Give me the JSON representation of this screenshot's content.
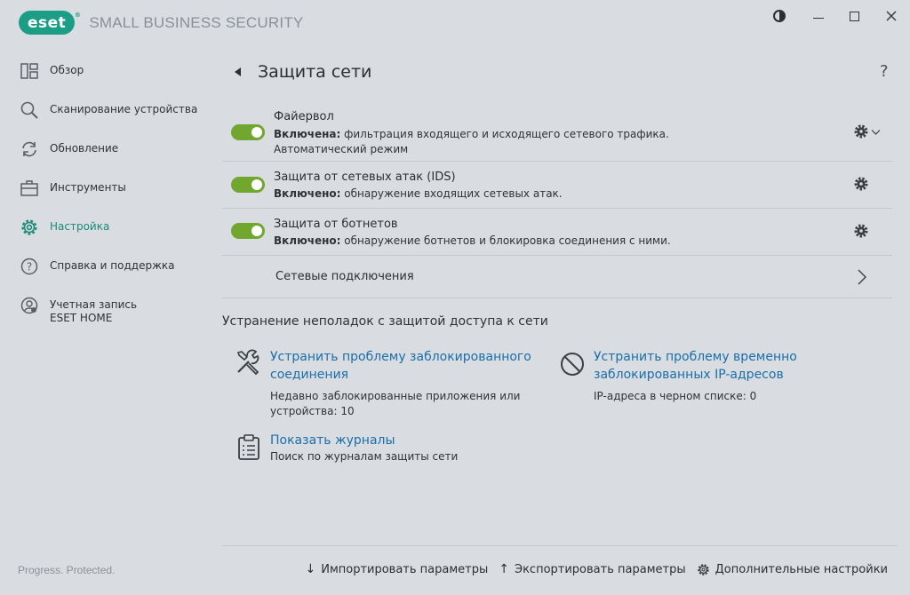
{
  "app": {
    "logo_text": "eset",
    "logo_tm": "®",
    "product_name": "SMALL BUSINESS SECURITY",
    "status_text": "Progress. Protected."
  },
  "sidebar": {
    "items": [
      {
        "label": "Обзор",
        "icon": "overview-icon"
      },
      {
        "label": "Сканирование устройства",
        "icon": "search-icon"
      },
      {
        "label": "Обновление",
        "icon": "refresh-icon"
      },
      {
        "label": "Инструменты",
        "icon": "briefcase-icon"
      },
      {
        "label": "Настройка",
        "icon": "gear-icon",
        "active": true
      },
      {
        "label": "Справка и поддержка",
        "icon": "help-icon"
      },
      {
        "label": "Учетная запись ESET HOME",
        "icon": "account-icon"
      }
    ]
  },
  "main": {
    "title": "Защита сети",
    "help": "?",
    "rows": [
      {
        "title": "Файервол",
        "status_bold": "Включена:",
        "status_text": " фильтрация входящего и исходящего сетевого трафика.",
        "extra": "Автоматический режим",
        "enabled": true
      },
      {
        "title": "Защита от сетевых атак (IDS)",
        "status_bold": "Включено:",
        "status_text": " обнаружение входящих сетевых атак.",
        "enabled": true
      },
      {
        "title": "Защита от ботнетов",
        "status_bold": "Включено:",
        "status_text": " обнаружение ботнетов и блокировка соединения с ними.",
        "enabled": true
      },
      {
        "title": "Сетевые подключения"
      }
    ],
    "troubleshoot": {
      "title": "Устранение неполадок с защитой доступа к сети",
      "cards": [
        {
          "icon": "tools-icon",
          "link_line1": "Устранить проблему заблокированного",
          "link_line2": "соединения",
          "desc_line1": "Недавно заблокированные приложения или",
          "desc_line2": "устройства: 10"
        },
        {
          "icon": "blocked-icon",
          "link_line1": "Устранить проблему временно",
          "link_line2": "заблокированных IP-адресов",
          "desc_line1": "IP-адреса в черном списке: 0"
        },
        {
          "icon": "clipboard-icon",
          "link_line1": "Показать журналы",
          "desc_line1": "Поиск по журналам защиты сети"
        }
      ]
    }
  },
  "footer": {
    "import_label": "Импортировать параметры",
    "export_label": "Экспортировать параметры",
    "advanced_label": "Дополнительные настройки"
  },
  "colors": {
    "brand": "#1b9d86",
    "toggle_on": "#71a72e",
    "link": "#1a6fa8",
    "background": "#d9dde2"
  }
}
